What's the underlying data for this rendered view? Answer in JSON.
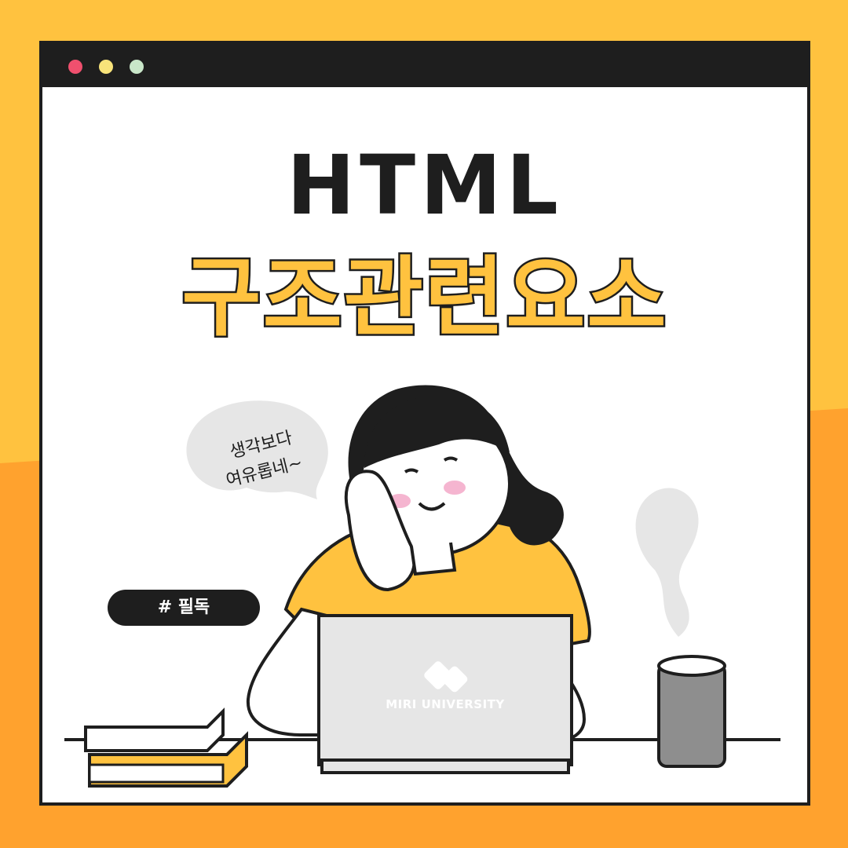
{
  "window": {
    "controls": [
      "close-dot",
      "minimize-dot",
      "maximize-dot"
    ]
  },
  "title": {
    "main": "HTML",
    "sub": "구조관련요소"
  },
  "tag": {
    "label": "# 필독"
  },
  "speech_bubble": {
    "line1": "생각보다",
    "line2": "여유롭네~"
  },
  "laptop": {
    "brand": "MIRI UNIVERSITY"
  },
  "colors": {
    "background_top": "#FFC23F",
    "background_bottom": "#FFA22E",
    "accent_yellow": "#FFC23F",
    "outline": "#1e1e1e",
    "laptop_gray": "#E6E6E6"
  }
}
